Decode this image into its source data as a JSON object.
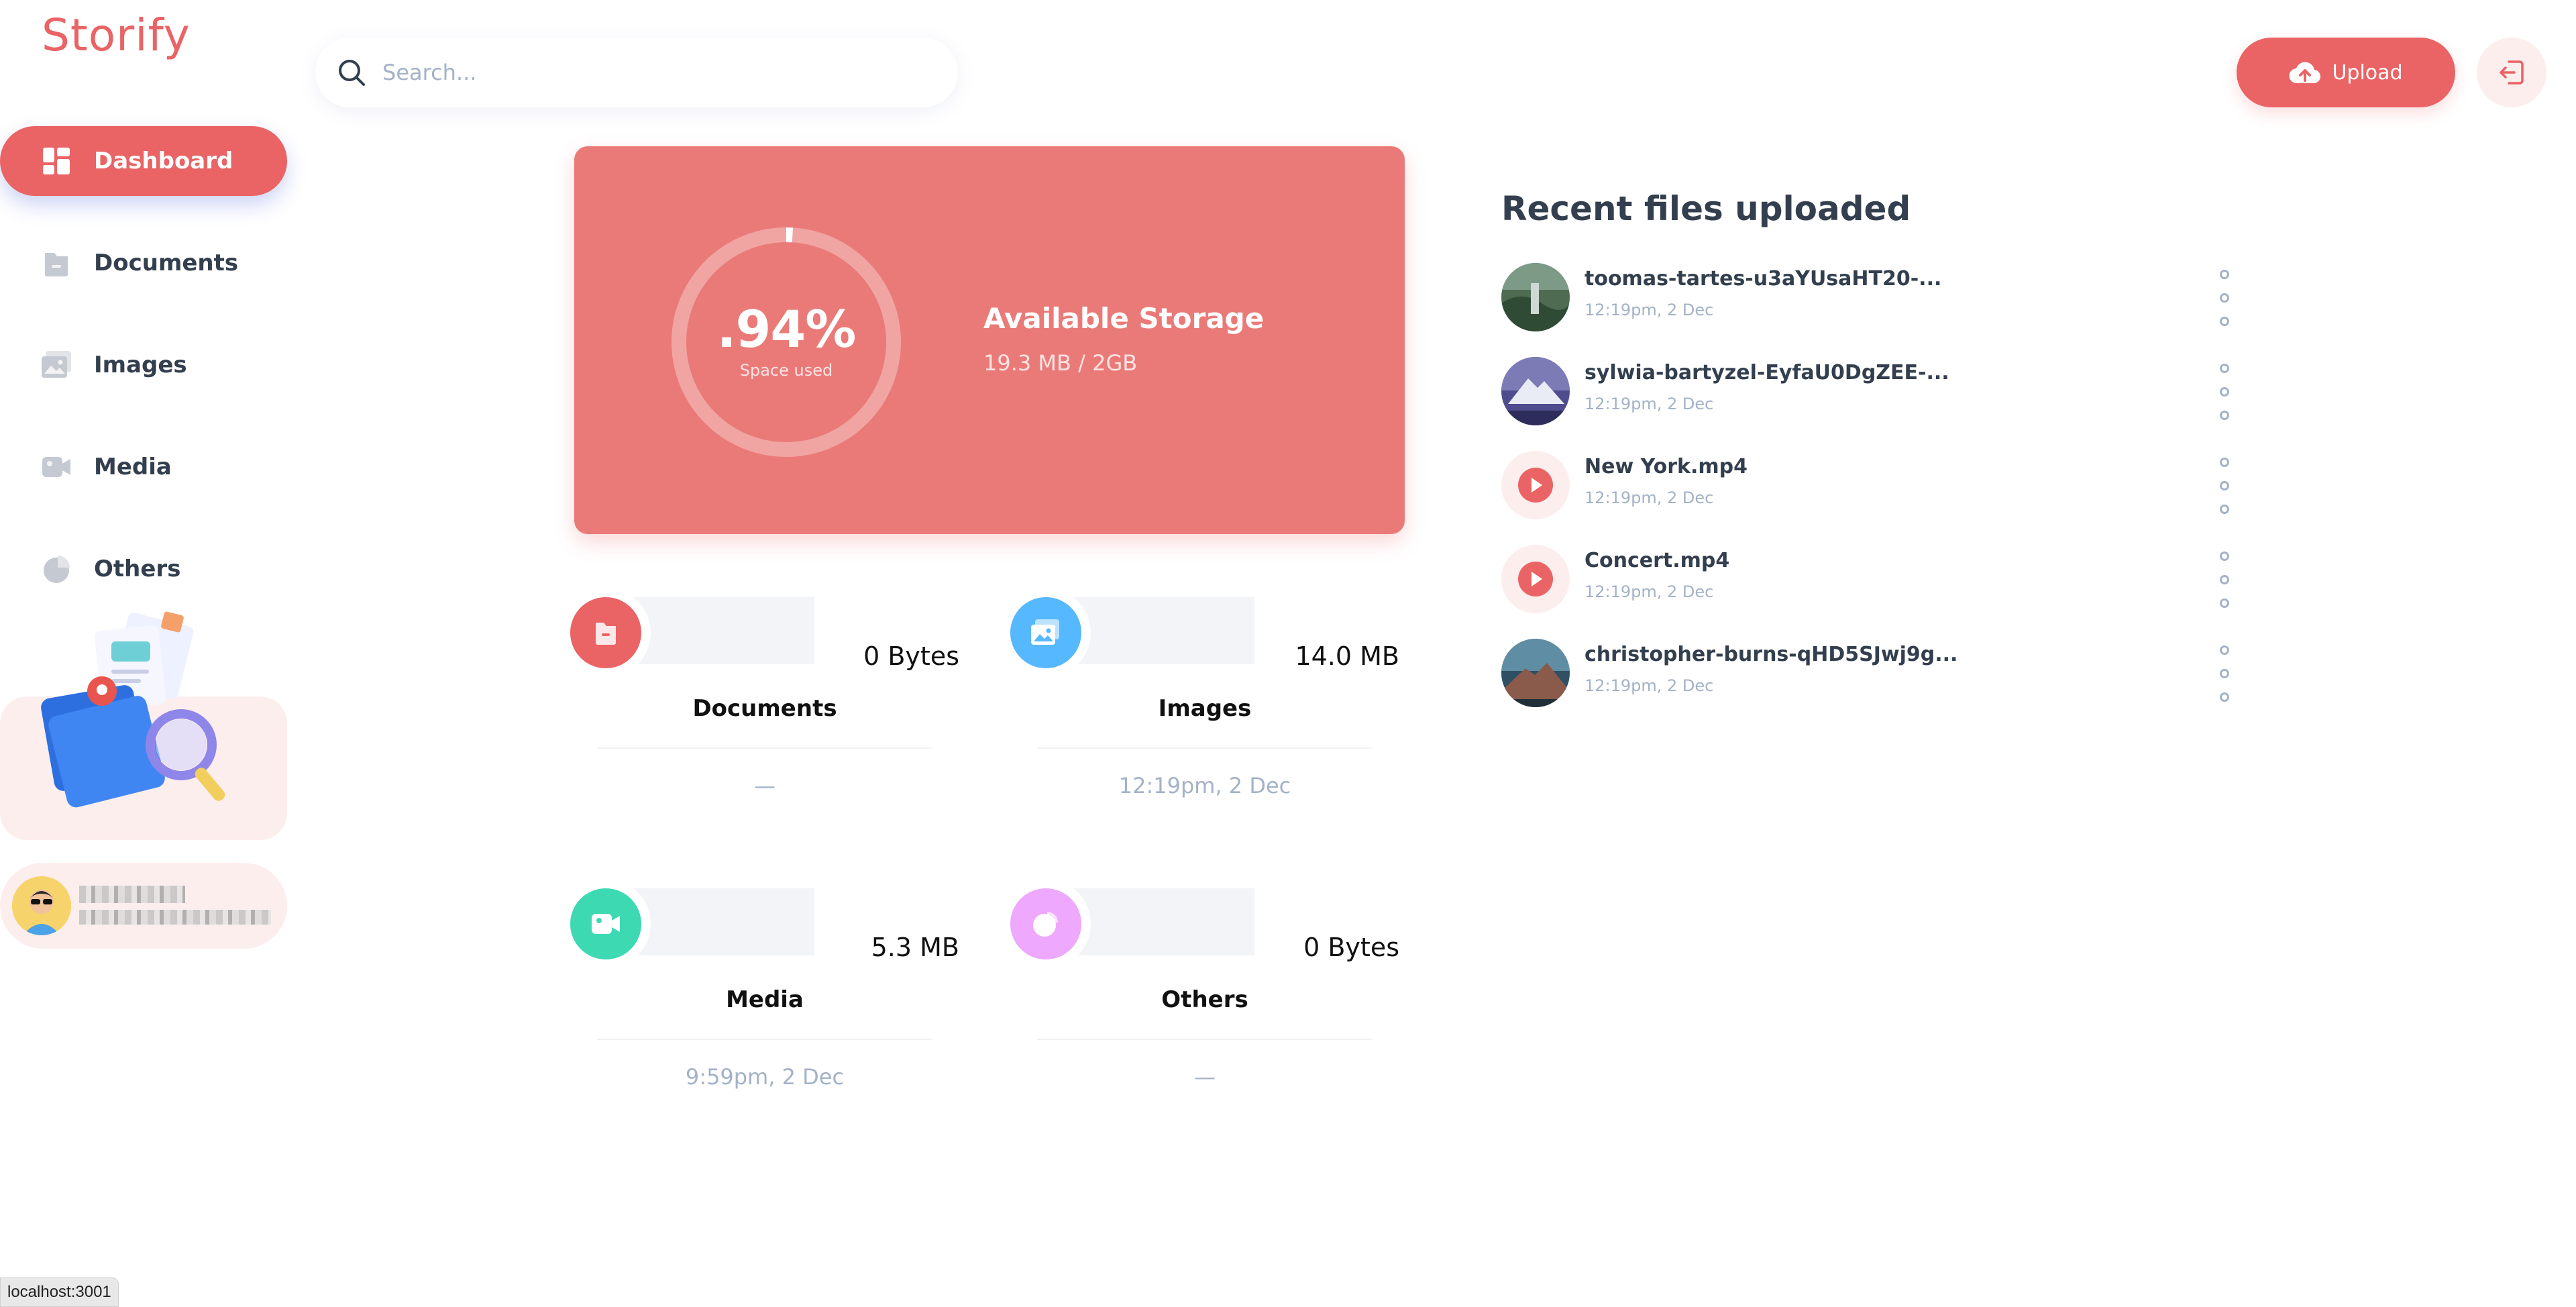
{
  "app": {
    "logo": "Storify"
  },
  "sidebar": {
    "items": [
      {
        "label": "Dashboard",
        "icon": "dashboard-icon",
        "active": true
      },
      {
        "label": "Documents",
        "icon": "documents-icon",
        "active": false
      },
      {
        "label": "Images",
        "icon": "images-icon",
        "active": false
      },
      {
        "label": "Media",
        "icon": "media-icon",
        "active": false
      },
      {
        "label": "Others",
        "icon": "others-icon",
        "active": false
      }
    ]
  },
  "header": {
    "search_placeholder": "Search...",
    "upload_label": "Upload"
  },
  "storage": {
    "percent_label": ".94%",
    "percent_value": 0.94,
    "space_used_label": "Space used",
    "title": "Available Storage",
    "usage": "19.3 MB / 2GB"
  },
  "summary": [
    {
      "title": "Documents",
      "size": "0 Bytes",
      "date": "—",
      "color": "#ea6365",
      "icon": "documents-icon"
    },
    {
      "title": "Images",
      "size": "14.0 MB",
      "date": "12:19pm, 2 Dec",
      "color": "#56b8ff",
      "icon": "images-icon"
    },
    {
      "title": "Media",
      "size": "5.3 MB",
      "date": "9:59pm, 2 Dec",
      "color": "#3dd9b3",
      "icon": "video-icon"
    },
    {
      "title": "Others",
      "size": "0 Bytes",
      "date": "—",
      "color": "#eea8fd",
      "icon": "pie-icon"
    }
  ],
  "recent": {
    "title": "Recent files uploaded",
    "files": [
      {
        "name": "toomas-tartes-u3aYUsaHT20-...",
        "date": "12:19pm, 2 Dec",
        "type": "image"
      },
      {
        "name": "sylwia-bartyzel-EyfaU0DgZEE-...",
        "date": "12:19pm, 2 Dec",
        "type": "image"
      },
      {
        "name": "New York.mp4",
        "date": "12:19pm, 2 Dec",
        "type": "video"
      },
      {
        "name": "Concert.mp4",
        "date": "12:19pm, 2 Dec",
        "type": "video"
      },
      {
        "name": "christopher-burns-qHD5SJwj9g...",
        "date": "12:19pm, 2 Dec",
        "type": "image"
      }
    ]
  },
  "statusbar": {
    "url": "localhost:3001"
  },
  "colors": {
    "brand": "#ea6365",
    "card": "#ea7a78",
    "light_bg": "#fdeeee",
    "muted": "#a3b2c7",
    "text": "#333f4e"
  }
}
